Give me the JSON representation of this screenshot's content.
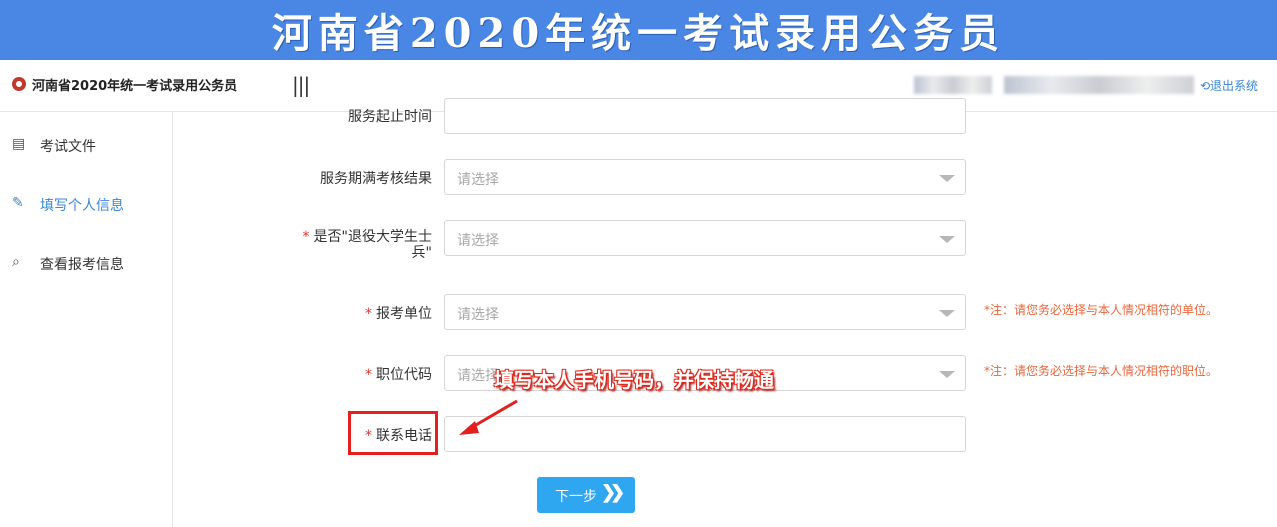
{
  "banner": {
    "title": "河南省2020年统一考试录用公务员"
  },
  "header": {
    "title": "河南省2020年统一考试录用公务员",
    "menu_toggle": "|||",
    "logout": "⟲退出系统"
  },
  "sidebar": {
    "items": [
      {
        "label": "考试文件",
        "icon": "document-icon",
        "glyph": "▤",
        "active": false
      },
      {
        "label": "填写个人信息",
        "icon": "edit-list-icon",
        "glyph": "✎",
        "active": true
      },
      {
        "label": "查看报考信息",
        "icon": "user-search-icon",
        "glyph": "⌕",
        "active": false
      }
    ]
  },
  "form": {
    "fields": [
      {
        "label": "服务起止时间",
        "required": false
      },
      {
        "label": "服务期满考核结果",
        "required": false,
        "placeholder": "请选择"
      },
      {
        "label_line1": "是否\"退役大学生士",
        "label_line2": "兵\"",
        "required": true,
        "placeholder": "请选择"
      },
      {
        "label": "报考单位",
        "required": true,
        "placeholder": "请选择",
        "note": "*注：请您务必选择与本人情况相符的单位。"
      },
      {
        "label": "职位代码",
        "required": true,
        "placeholder": "请选择",
        "note": "*注：请您务必选择与本人情况相符的职位。"
      },
      {
        "label": "联系电话",
        "required": true
      }
    ],
    "required_mark": "*",
    "next_button": "下一步",
    "next_chevron": "❯❯"
  },
  "annotation": {
    "text": "填写本人手机号码，并保持畅通",
    "color": "#e31f1f"
  },
  "colors": {
    "banner": "#4a86e3",
    "accent": "#3a86d8",
    "button": "#2fa6f0",
    "required": "#e0362e",
    "note": "#e8663c"
  }
}
